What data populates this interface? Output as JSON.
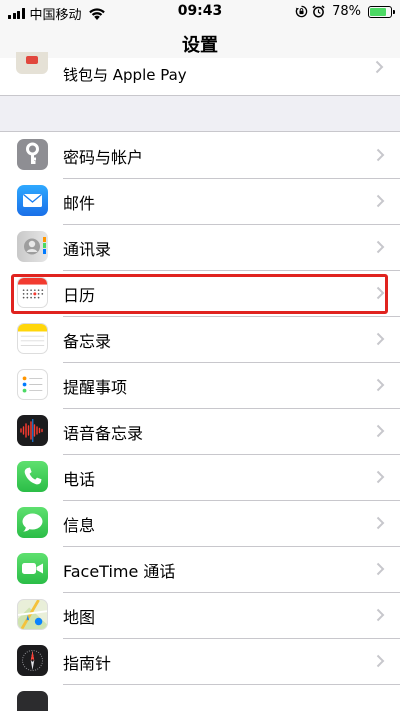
{
  "status_bar": {
    "carrier": "中国移动",
    "time": "09:43",
    "battery_percent": "78%",
    "battery_level": 0.78,
    "icons": [
      "signal-icon",
      "wifi-icon",
      "orientation-lock-icon",
      "alarm-icon",
      "battery-icon"
    ]
  },
  "nav": {
    "title": "设置"
  },
  "partial_item": {
    "label": "钱包与 Apple Pay",
    "icon": "wallet-icon"
  },
  "settings_items": [
    {
      "label": "密码与帐户",
      "icon": "key-icon",
      "color": "#8e8e93"
    },
    {
      "label": "邮件",
      "icon": "mail-icon",
      "color": "#1a8cff"
    },
    {
      "label": "通讯录",
      "icon": "contacts-icon",
      "color": "#d9d9d9"
    },
    {
      "label": "日历",
      "icon": "calendar-icon",
      "color": "#ffffff",
      "highlighted": true
    },
    {
      "label": "备忘录",
      "icon": "notes-icon",
      "color": "#ffffff"
    },
    {
      "label": "提醒事项",
      "icon": "reminders-icon",
      "color": "#ffffff"
    },
    {
      "label": "语音备忘录",
      "icon": "voice-memos-icon",
      "color": "#1c1c1e"
    },
    {
      "label": "电话",
      "icon": "phone-icon",
      "color": "#34c759"
    },
    {
      "label": "信息",
      "icon": "messages-icon",
      "color": "#34c759"
    },
    {
      "label": "FaceTime 通话",
      "icon": "facetime-icon",
      "color": "#34c759"
    },
    {
      "label": "地图",
      "icon": "maps-icon",
      "color": "#e8f0d8"
    },
    {
      "label": "指南针",
      "icon": "compass-icon",
      "color": "#1c1c1e"
    }
  ],
  "highlight_color": "#e0231f"
}
